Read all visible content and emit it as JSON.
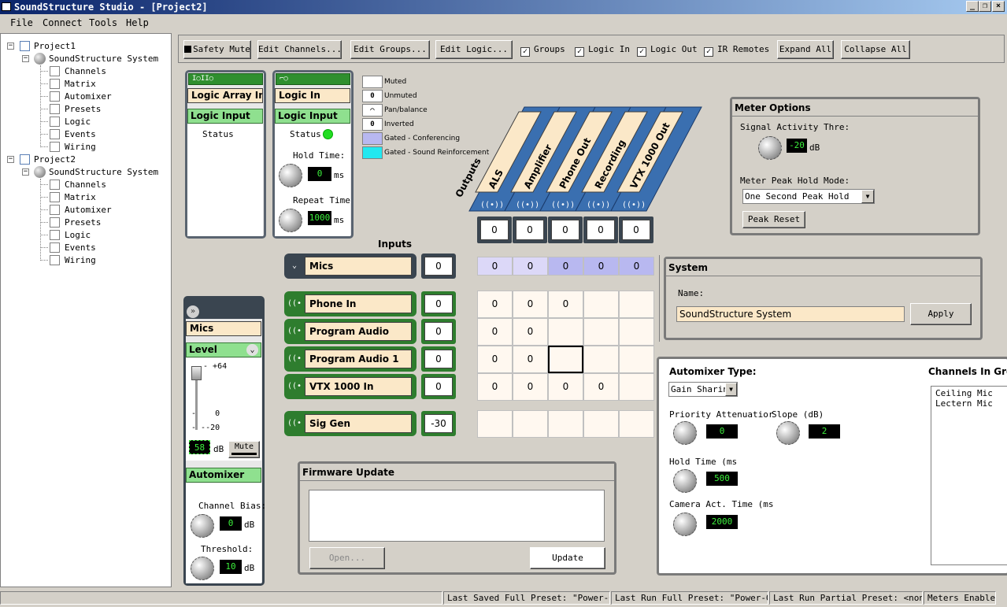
{
  "window": {
    "title": "SoundStructure Studio - [Project2]"
  },
  "menu": [
    "File",
    "Connect",
    "Tools",
    "Help"
  ],
  "tree": {
    "projects": [
      {
        "name": "Project1",
        "system": "SoundStructure System",
        "items": [
          "Channels",
          "Matrix",
          "Automixer",
          "Presets",
          "Logic",
          "Events",
          "Wiring"
        ]
      },
      {
        "name": "Project2",
        "system": "SoundStructure System",
        "items": [
          "Channels",
          "Matrix",
          "Automixer",
          "Presets",
          "Logic",
          "Events",
          "Wiring"
        ]
      }
    ]
  },
  "toolbar": {
    "safety_mute": "Safety Mute",
    "edit_channels": "Edit Channels...",
    "edit_groups": "Edit Groups...",
    "edit_logic": "Edit Logic...",
    "groups": "Groups",
    "logic_in": "Logic In",
    "logic_out": "Logic Out",
    "ir_remotes": "IR Remotes",
    "expand_all": "Expand All",
    "collapse_all": "Collapse All"
  },
  "logic_array": {
    "name": "Logic Array In",
    "section": "Logic Input",
    "status_label": "Status"
  },
  "logic_in": {
    "name": "Logic In",
    "section": "Logic Input",
    "status_label": "Status",
    "hold_label": "Hold Time:",
    "hold_value": "0",
    "hold_unit": "ms",
    "repeat_label": "Repeat Time",
    "repeat_value": "1000",
    "repeat_unit": "ms",
    "status_color": "#22dd22"
  },
  "legend": [
    {
      "symbol": "",
      "label": "Muted",
      "color": "#ffffff"
    },
    {
      "symbol": "0",
      "label": "Unmuted",
      "color": "#ffffff"
    },
    {
      "symbol": "⌒",
      "label": "Pan/balance",
      "color": "#ffffff"
    },
    {
      "symbol": "0",
      "label": "Inverted",
      "color": "#ffffff"
    },
    {
      "symbol": "",
      "label": "Gated - Conferencing",
      "color": "#b8b8f0"
    },
    {
      "symbol": "",
      "label": "Gated - Sound Reinforcement",
      "color": "#22e8f0"
    }
  ],
  "matrix": {
    "outputs_label": "Outputs",
    "inputs_label": "Inputs",
    "outputs": [
      "ALS",
      "Amplifier",
      "Phone Out",
      "Recording",
      "VTX 1000 Out"
    ],
    "output_values": [
      "0",
      "0",
      "0",
      "0",
      "0"
    ],
    "group_row": {
      "name": "Mics",
      "value": "0",
      "cells": [
        "0",
        "0",
        "0",
        "0",
        "0"
      ]
    },
    "inputs": [
      {
        "name": "Phone In",
        "value": "0",
        "cells": [
          "0",
          "0",
          "0",
          "",
          ""
        ]
      },
      {
        "name": "Program Audio",
        "value": "0",
        "cells": [
          "0",
          "0",
          "",
          "",
          ""
        ]
      },
      {
        "name": "Program Audio 1",
        "value": "0",
        "cells": [
          "0",
          "0",
          "",
          "",
          ""
        ]
      },
      {
        "name": "VTX 1000 In",
        "value": "0",
        "cells": [
          "0",
          "0",
          "0",
          "0",
          ""
        ]
      }
    ],
    "sig_gen": {
      "name": "Sig Gen",
      "value": "-30",
      "cells": [
        "",
        "",
        "",
        "",
        ""
      ]
    }
  },
  "channel_strip": {
    "name": "Mics",
    "level_label": "Level",
    "scale_top": "+64",
    "scale_mid": "0",
    "scale_low": "-20",
    "level_value": "58",
    "level_unit": "dB",
    "mute_label": "Mute",
    "automixer_label": "Automixer",
    "bias_label": "Channel Bias:",
    "bias_value": "0",
    "bias_unit": "dB",
    "threshold_label": "Threshold:",
    "threshold_value": "10",
    "threshold_unit": "dB"
  },
  "firmware": {
    "title": "Firmware Update",
    "open_label": "Open...",
    "update_label": "Update"
  },
  "meter_options": {
    "title": "Meter Options",
    "signal_label": "Signal Activity Thre:",
    "signal_value": "-20",
    "signal_unit": "dB",
    "peak_mode_label": "Meter Peak Hold Mode:",
    "peak_mode_value": "One Second Peak Hold",
    "peak_reset_label": "Peak Reset"
  },
  "system": {
    "title": "System",
    "name_label": "Name:",
    "name_value": "SoundStructure System",
    "apply_label": "Apply"
  },
  "automixer": {
    "type_label": "Automixer Type:",
    "type_value": "Gain Sharin",
    "priority_label": "Priority Attenuatior",
    "priority_value": "0",
    "slope_label": "Slope (dB)",
    "slope_value": "2",
    "hold_label": "Hold Time (ms",
    "hold_value": "500",
    "camera_label": "Camera Act. Time (ms",
    "camera_value": "2000",
    "channels_label": "Channels In Group",
    "channels": [
      "Ceiling Mic",
      "Lectern Mic"
    ]
  },
  "status": {
    "saved": "Last Saved Full Preset: \"Power-On\"",
    "run_full": "Last Run Full Preset: \"Power-On\"",
    "run_partial": "Last Run Partial Preset: <none>",
    "meters": "Meters Enabled"
  },
  "colors": {
    "green": "#2e7d2e",
    "light_green": "#8fe08f",
    "cream": "#fbe8c8",
    "gated_conf": "#b8b8f0",
    "lcd_text": "#3cf03c"
  }
}
